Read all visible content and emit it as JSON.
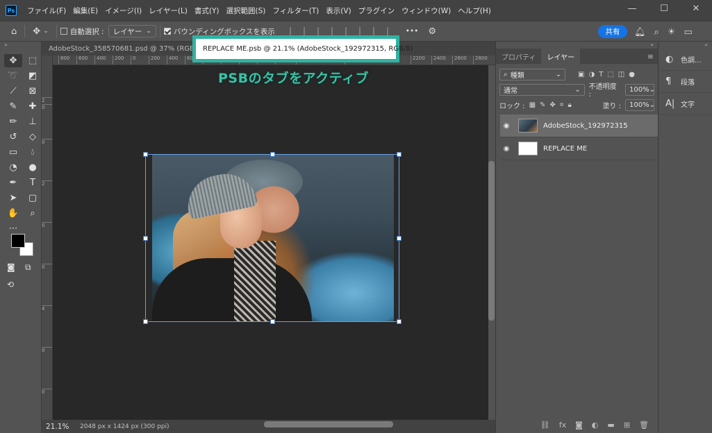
{
  "app": {
    "logo": "Ps"
  },
  "menu": [
    "ファイル(F)",
    "編集(E)",
    "イメージ(I)",
    "レイヤー(L)",
    "書式(Y)",
    "選択範囲(S)",
    "フィルター(T)",
    "表示(V)",
    "プラグイン",
    "ウィンドウ(W)",
    "ヘルプ(H)"
  ],
  "window_controls": {
    "minimize": "—",
    "maximize": "☐",
    "close": "✕"
  },
  "options": {
    "auto_select_label": "自動選択 :",
    "auto_select_target": "レイヤー",
    "bounding_box_label": "バウンディングボックスを表示",
    "more": "•••",
    "share": "共有"
  },
  "tabs": {
    "inactive": "AdobeStock_358570681.psd @ 37% (RGB/8) *",
    "active": "REPLACE ME.psb @ 21.1% (AdobeStock_192972315, RGB/8)",
    "close": "×"
  },
  "annotation": "PSBのタブをアクティブ",
  "ruler_top": [
    "800",
    "600",
    "400",
    "200",
    "0",
    "200",
    "400",
    "600",
    "800",
    "1000",
    "1200",
    "1400",
    "1600",
    "1800",
    "2000",
    "2200",
    "2400",
    "2600",
    "2800"
  ],
  "ruler_left": [
    "2",
    "0",
    "0",
    "2",
    "0",
    "0",
    "4",
    "0",
    "0",
    "6",
    "0",
    "0",
    "8",
    "0",
    "0",
    "1",
    "0",
    "0",
    "0"
  ],
  "status": {
    "zoom": "21.1%",
    "doc_info": "2048 px x 1424 px (300 ppi)"
  },
  "panel": {
    "tabs": [
      "プロパティ",
      "レイヤー"
    ],
    "filter_kind": "種類",
    "blend_mode": "通常",
    "opacity_label": "不透明度 :",
    "opacity_value": "100%",
    "lock_label": "ロック :",
    "fill_label": "塗り :",
    "fill_value": "100%",
    "layers": [
      {
        "name": "AdobeStock_192972315",
        "selected": true
      },
      {
        "name": "REPLACE ME",
        "selected": false
      }
    ]
  },
  "dock": [
    {
      "icon": "◐",
      "label": "色調..."
    },
    {
      "icon": "¶",
      "label": "段落"
    },
    {
      "icon": "A|",
      "label": "文字"
    }
  ],
  "colors": {
    "accent": "#2fb3a2",
    "annotation": "#36c3a7",
    "share": "#1473e6",
    "selection": "#6aa3e8"
  }
}
